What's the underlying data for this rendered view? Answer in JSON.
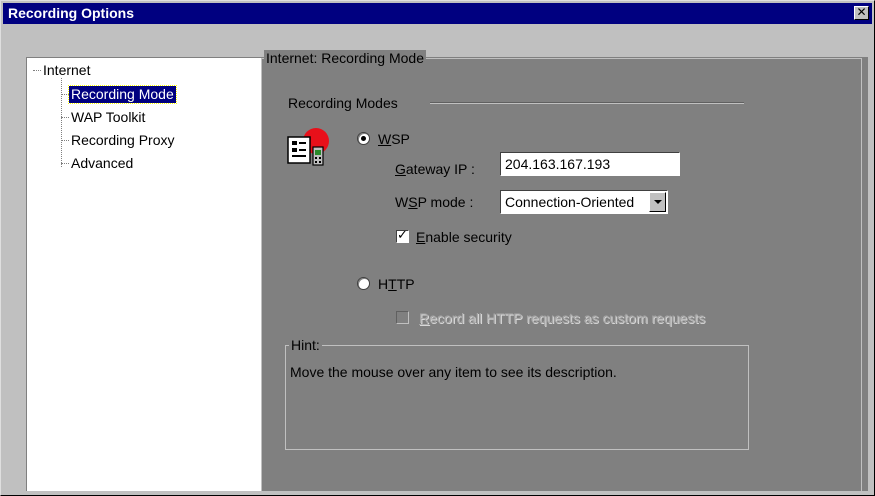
{
  "window": {
    "title": "Recording Options",
    "close_glyph": "✕"
  },
  "tree": {
    "items": [
      {
        "label": "Internet",
        "level": 0,
        "selected": false
      },
      {
        "label": "Recording Mode",
        "level": 1,
        "selected": true
      },
      {
        "label": "WAP Toolkit",
        "level": 1,
        "selected": false
      },
      {
        "label": "Recording Proxy",
        "level": 1,
        "selected": false
      },
      {
        "label": "Advanced",
        "level": 1,
        "selected": false
      }
    ]
  },
  "panel": {
    "group_title": "Internet: Recording Mode",
    "section_title": "Recording Modes",
    "wsp": {
      "radio_label_accel": "W",
      "radio_label_rest": "SP",
      "checked": true,
      "gateway_label_accel": "G",
      "gateway_label_rest": "ateway IP :",
      "gateway_value": "204.163.167.193",
      "mode_label_pre": "W",
      "mode_label_accel": "S",
      "mode_label_rest": "P mode :",
      "mode_value": "Connection-Oriented",
      "security_label_accel": "E",
      "security_label_rest": "nable security",
      "security_checked": true
    },
    "http": {
      "radio_label_pre": "H",
      "radio_label_accel": "T",
      "radio_label_rest": "TP",
      "checked": false,
      "custom_label_accel": "R",
      "custom_label_rest": "ecord all HTTP requests as custom requests",
      "custom_checked": false,
      "custom_enabled": false
    },
    "hint": {
      "title": "Hint:",
      "text": "Move the mouse over any item to see its description."
    }
  },
  "icons": {
    "mode_icon": "wap-phone-icon"
  },
  "colors": {
    "titlebar": "#000080",
    "selection": "#000080",
    "panel_bg": "#808080",
    "face": "#c0c0c0"
  }
}
